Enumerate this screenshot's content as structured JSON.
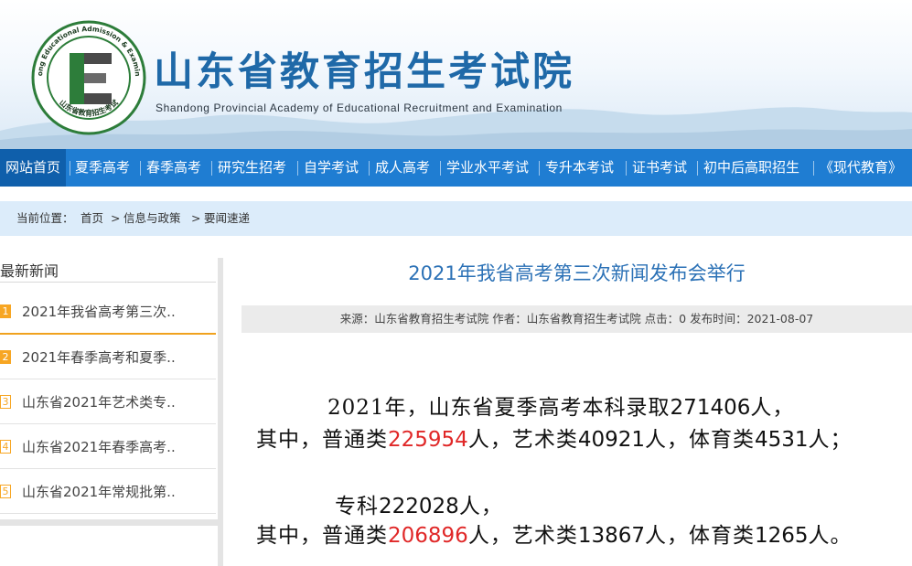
{
  "header": {
    "title": "山东省教育招生考试院",
    "subtitle": "Shandong Provincial Academy of Educational Recruitment and Examination",
    "logo_ring_text": "Shandong Educational Admission & Examinations",
    "logo_bottom_text": "山东省教育招生考试",
    "logo_icon": "letter-e-emblem",
    "brand_color": "#1f69a8"
  },
  "nav": {
    "items": [
      {
        "label": "网站首页",
        "active": true
      },
      {
        "label": "夏季高考"
      },
      {
        "label": "春季高考"
      },
      {
        "label": "研究生招考"
      },
      {
        "label": "自学考试"
      },
      {
        "label": "成人高考"
      },
      {
        "label": "学业水平考试"
      },
      {
        "label": "专升本考试"
      },
      {
        "label": "证书考试"
      },
      {
        "label": "初中后高职招生"
      },
      {
        "label": "《现代教育》"
      }
    ],
    "bg_color": "#1f7dd2"
  },
  "breadcrumb": {
    "prefix": "当前位置：",
    "items": [
      "首页",
      "信息与政策",
      "要闻速递"
    ],
    "separator": ">"
  },
  "sidebar": {
    "title": "最新新闻",
    "items": [
      {
        "num": "1",
        "text": "2021年我省高考第三次.."
      },
      {
        "num": "2",
        "text": "2021年春季高考和夏季.."
      },
      {
        "num": "3",
        "text": "山东省2021年艺术类专.."
      },
      {
        "num": "4",
        "text": "山东省2021年春季高考.."
      },
      {
        "num": "5",
        "text": "山东省2021年常规批第.."
      }
    ],
    "accent_color": "#f7a623"
  },
  "article": {
    "title": "2021年我省高考第三次新闻发布会举行",
    "meta": "来源：山东省教育招生考试院  作者：山东省教育招生考试院  点击：0  发布时间：2021-08-07",
    "line1_a": "2021年，山东省夏季高考本科录取",
    "line1_num": "271406",
    "line1_b": "人，",
    "line2_a": "其中，普通类",
    "line2_red": "225954",
    "line2_b": "人，艺术类",
    "line2_num1": "40921",
    "line2_c": "人，体育类",
    "line2_num2": "4531",
    "line2_d": "人；",
    "line3_a": "专科",
    "line3_num": "222028",
    "line3_b": "人，",
    "line4_a": "其中，普通类",
    "line4_red": "206896",
    "line4_b": "人，艺术类",
    "line4_num1": "13867",
    "line4_c": "人，体育类",
    "line4_num2": "1265",
    "line4_d": "人。",
    "highlight_color": "#e02828"
  }
}
